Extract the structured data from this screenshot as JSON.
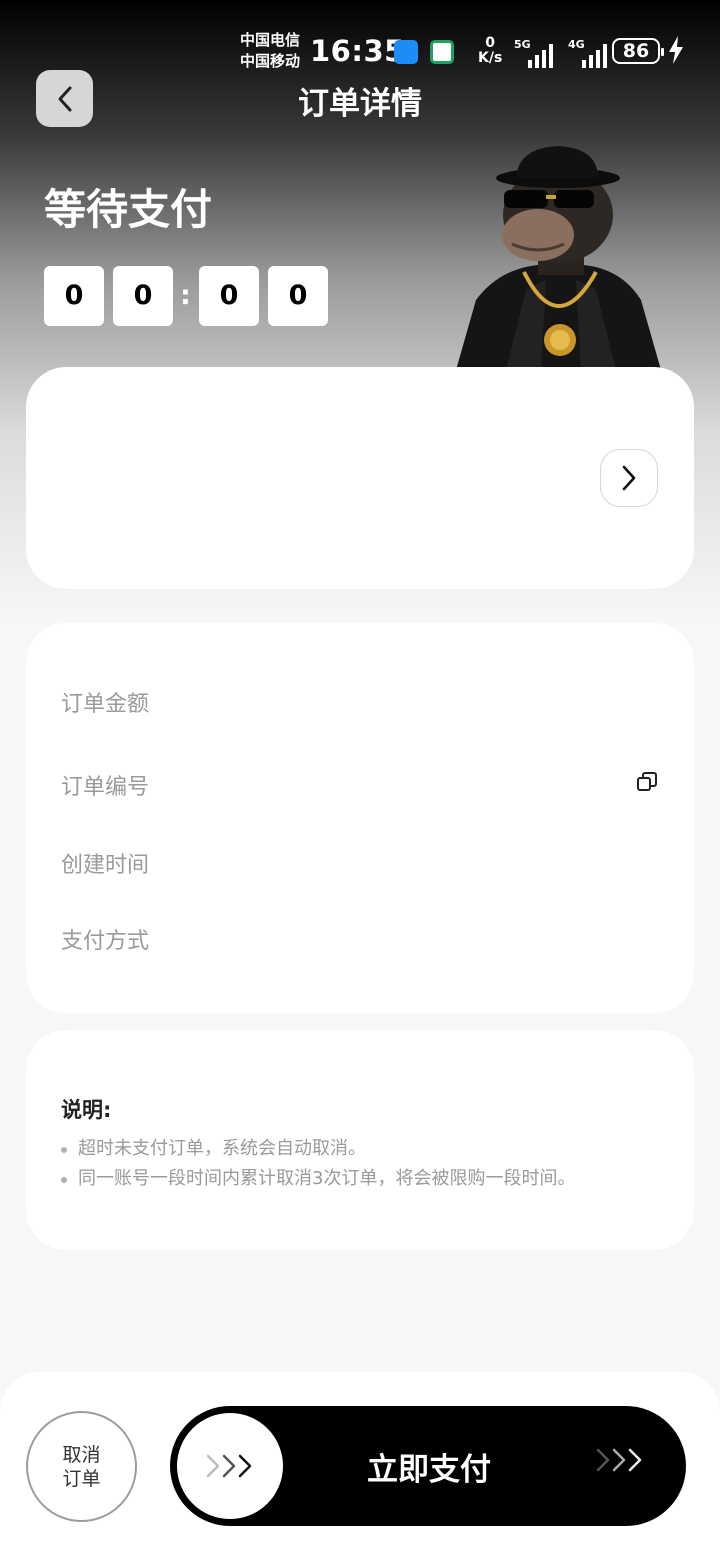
{
  "status_bar": {
    "carrier_1": "中国电信",
    "carrier_2": "中国移动",
    "time": "16:35",
    "net_speed_value": "0",
    "net_speed_unit": "K/s",
    "signal_1_label": "5G",
    "signal_2_label": "4G",
    "battery": "86"
  },
  "header": {
    "title": "订单详情",
    "back_icon": "chevron-left-icon"
  },
  "order_status": {
    "title": "等待支付",
    "countdown": [
      "0",
      "0",
      "0",
      "0"
    ],
    "separator": ":"
  },
  "product_card": {
    "arrow_icon": "chevron-right-icon"
  },
  "info": {
    "amount_label": "订单金额",
    "number_label": "订单编号",
    "created_label": "创建时间",
    "payment_label": "支付方式",
    "copy_icon": "copy-icon"
  },
  "note": {
    "title": "说明:",
    "items": [
      "超时未支付订单，系统会自动取消。",
      "同一账号一段时间内累计取消3次订单，将会被限购一段时间。"
    ]
  },
  "bottom": {
    "cancel_line1": "取消",
    "cancel_line2": "订单",
    "pay_label": "立即支付"
  },
  "colors": {
    "accent": "#000000",
    "card": "#ffffff",
    "muted_text": "#9a9a9a",
    "background": "#f7f7f7"
  }
}
